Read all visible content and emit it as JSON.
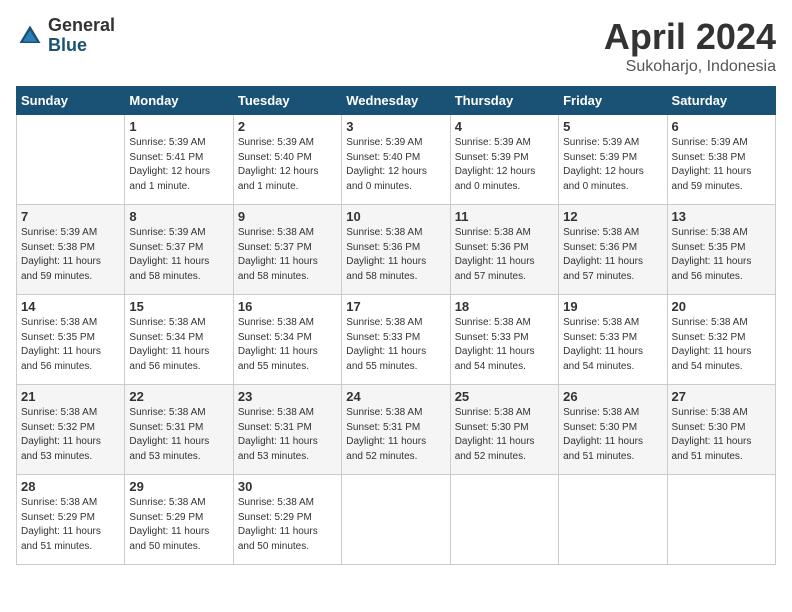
{
  "header": {
    "logo_general": "General",
    "logo_blue": "Blue",
    "month_title": "April 2024",
    "subtitle": "Sukoharjo, Indonesia"
  },
  "days_of_week": [
    "Sunday",
    "Monday",
    "Tuesday",
    "Wednesday",
    "Thursday",
    "Friday",
    "Saturday"
  ],
  "weeks": [
    [
      {
        "day": "",
        "detail": ""
      },
      {
        "day": "1",
        "detail": "Sunrise: 5:39 AM\nSunset: 5:41 PM\nDaylight: 12 hours\nand 1 minute."
      },
      {
        "day": "2",
        "detail": "Sunrise: 5:39 AM\nSunset: 5:40 PM\nDaylight: 12 hours\nand 1 minute."
      },
      {
        "day": "3",
        "detail": "Sunrise: 5:39 AM\nSunset: 5:40 PM\nDaylight: 12 hours\nand 0 minutes."
      },
      {
        "day": "4",
        "detail": "Sunrise: 5:39 AM\nSunset: 5:39 PM\nDaylight: 12 hours\nand 0 minutes."
      },
      {
        "day": "5",
        "detail": "Sunrise: 5:39 AM\nSunset: 5:39 PM\nDaylight: 12 hours\nand 0 minutes."
      },
      {
        "day": "6",
        "detail": "Sunrise: 5:39 AM\nSunset: 5:38 PM\nDaylight: 11 hours\nand 59 minutes."
      }
    ],
    [
      {
        "day": "7",
        "detail": "Sunrise: 5:39 AM\nSunset: 5:38 PM\nDaylight: 11 hours\nand 59 minutes."
      },
      {
        "day": "8",
        "detail": "Sunrise: 5:39 AM\nSunset: 5:37 PM\nDaylight: 11 hours\nand 58 minutes."
      },
      {
        "day": "9",
        "detail": "Sunrise: 5:38 AM\nSunset: 5:37 PM\nDaylight: 11 hours\nand 58 minutes."
      },
      {
        "day": "10",
        "detail": "Sunrise: 5:38 AM\nSunset: 5:36 PM\nDaylight: 11 hours\nand 58 minutes."
      },
      {
        "day": "11",
        "detail": "Sunrise: 5:38 AM\nSunset: 5:36 PM\nDaylight: 11 hours\nand 57 minutes."
      },
      {
        "day": "12",
        "detail": "Sunrise: 5:38 AM\nSunset: 5:36 PM\nDaylight: 11 hours\nand 57 minutes."
      },
      {
        "day": "13",
        "detail": "Sunrise: 5:38 AM\nSunset: 5:35 PM\nDaylight: 11 hours\nand 56 minutes."
      }
    ],
    [
      {
        "day": "14",
        "detail": "Sunrise: 5:38 AM\nSunset: 5:35 PM\nDaylight: 11 hours\nand 56 minutes."
      },
      {
        "day": "15",
        "detail": "Sunrise: 5:38 AM\nSunset: 5:34 PM\nDaylight: 11 hours\nand 56 minutes."
      },
      {
        "day": "16",
        "detail": "Sunrise: 5:38 AM\nSunset: 5:34 PM\nDaylight: 11 hours\nand 55 minutes."
      },
      {
        "day": "17",
        "detail": "Sunrise: 5:38 AM\nSunset: 5:33 PM\nDaylight: 11 hours\nand 55 minutes."
      },
      {
        "day": "18",
        "detail": "Sunrise: 5:38 AM\nSunset: 5:33 PM\nDaylight: 11 hours\nand 54 minutes."
      },
      {
        "day": "19",
        "detail": "Sunrise: 5:38 AM\nSunset: 5:33 PM\nDaylight: 11 hours\nand 54 minutes."
      },
      {
        "day": "20",
        "detail": "Sunrise: 5:38 AM\nSunset: 5:32 PM\nDaylight: 11 hours\nand 54 minutes."
      }
    ],
    [
      {
        "day": "21",
        "detail": "Sunrise: 5:38 AM\nSunset: 5:32 PM\nDaylight: 11 hours\nand 53 minutes."
      },
      {
        "day": "22",
        "detail": "Sunrise: 5:38 AM\nSunset: 5:31 PM\nDaylight: 11 hours\nand 53 minutes."
      },
      {
        "day": "23",
        "detail": "Sunrise: 5:38 AM\nSunset: 5:31 PM\nDaylight: 11 hours\nand 53 minutes."
      },
      {
        "day": "24",
        "detail": "Sunrise: 5:38 AM\nSunset: 5:31 PM\nDaylight: 11 hours\nand 52 minutes."
      },
      {
        "day": "25",
        "detail": "Sunrise: 5:38 AM\nSunset: 5:30 PM\nDaylight: 11 hours\nand 52 minutes."
      },
      {
        "day": "26",
        "detail": "Sunrise: 5:38 AM\nSunset: 5:30 PM\nDaylight: 11 hours\nand 51 minutes."
      },
      {
        "day": "27",
        "detail": "Sunrise: 5:38 AM\nSunset: 5:30 PM\nDaylight: 11 hours\nand 51 minutes."
      }
    ],
    [
      {
        "day": "28",
        "detail": "Sunrise: 5:38 AM\nSunset: 5:29 PM\nDaylight: 11 hours\nand 51 minutes."
      },
      {
        "day": "29",
        "detail": "Sunrise: 5:38 AM\nSunset: 5:29 PM\nDaylight: 11 hours\nand 50 minutes."
      },
      {
        "day": "30",
        "detail": "Sunrise: 5:38 AM\nSunset: 5:29 PM\nDaylight: 11 hours\nand 50 minutes."
      },
      {
        "day": "",
        "detail": ""
      },
      {
        "day": "",
        "detail": ""
      },
      {
        "day": "",
        "detail": ""
      },
      {
        "day": "",
        "detail": ""
      }
    ]
  ]
}
